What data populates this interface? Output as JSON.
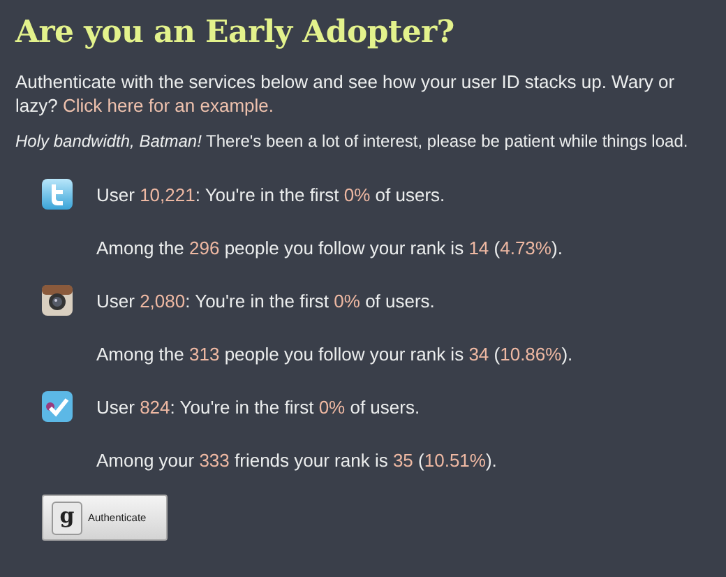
{
  "title": "Are you an Early Adopter?",
  "intro": {
    "text": "Authenticate with the services below and see how your user ID stacks up. Wary or lazy?",
    "link": "Click here for an example."
  },
  "notice": "*Holy bandwidth, Batman!* There's been a lot of interest, please be patient while things load.",
  "services": [
    {
      "kind": "twitter",
      "lines": [
        [
          {
            "text": "User ",
            "highlight": false
          },
          {
            "text": "10,221",
            "highlight": true
          },
          {
            "text": ": You're in the first ",
            "highlight": false
          },
          {
            "text": "0%",
            "highlight": true
          },
          {
            "text": " of users.",
            "highlight": false
          }
        ],
        [
          {
            "text": "Among the ",
            "highlight": false
          },
          {
            "text": "296",
            "highlight": true
          },
          {
            "text": " people you follow your rank is ",
            "highlight": false
          },
          {
            "text": "14",
            "highlight": true
          },
          {
            "text": " (",
            "highlight": false
          },
          {
            "text": "4.73%",
            "highlight": true
          },
          {
            "text": ").",
            "highlight": false
          }
        ]
      ]
    },
    {
      "kind": "instagram",
      "lines": [
        [
          {
            "text": "User ",
            "highlight": false
          },
          {
            "text": "2,080",
            "highlight": true
          },
          {
            "text": ": You're in the first ",
            "highlight": false
          },
          {
            "text": "0%",
            "highlight": true
          },
          {
            "text": " of users.",
            "highlight": false
          }
        ],
        [
          {
            "text": "Among the ",
            "highlight": false
          },
          {
            "text": "313",
            "highlight": true
          },
          {
            "text": " people you follow your rank is ",
            "highlight": false
          },
          {
            "text": "34",
            "highlight": true
          },
          {
            "text": " (",
            "highlight": false
          },
          {
            "text": "10.86%",
            "highlight": true
          },
          {
            "text": ").",
            "highlight": false
          }
        ]
      ]
    },
    {
      "kind": "foursquare",
      "lines": [
        [
          {
            "text": "User ",
            "highlight": false
          },
          {
            "text": "824",
            "highlight": true
          },
          {
            "text": ": You're in the first ",
            "highlight": false
          },
          {
            "text": "0%",
            "highlight": true
          },
          {
            "text": " of users.",
            "highlight": false
          }
        ],
        [
          {
            "text": "Among your ",
            "highlight": false
          },
          {
            "text": "333",
            "highlight": true
          },
          {
            "text": " friends your rank is ",
            "highlight": false
          },
          {
            "text": "35",
            "highlight": true
          },
          {
            "text": " (",
            "highlight": false
          },
          {
            "text": "10.51%",
            "highlight": true
          },
          {
            "text": ").",
            "highlight": false
          }
        ]
      ]
    }
  ],
  "button": {
    "icon_letter": "g",
    "label": "Authenticate"
  }
}
